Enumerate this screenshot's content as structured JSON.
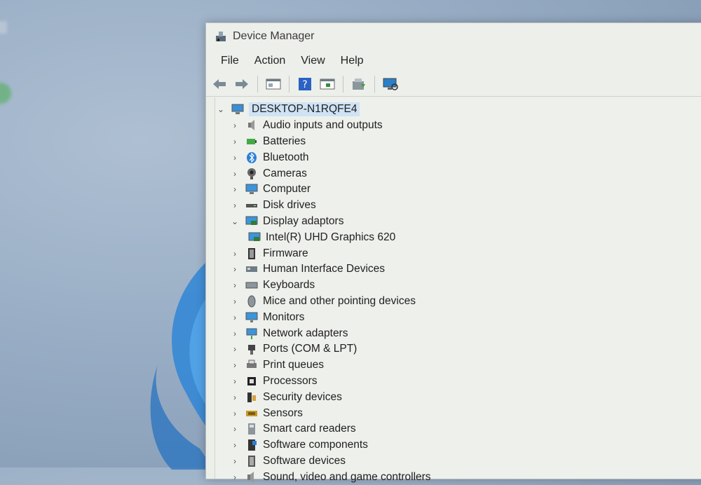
{
  "window": {
    "title": "Device Manager"
  },
  "menu": [
    "File",
    "Action",
    "View",
    "Help"
  ],
  "tree": {
    "root": "DESKTOP-N1RQFE4",
    "categories": [
      {
        "label": "Audio inputs and outputs",
        "icon": "speaker-icon"
      },
      {
        "label": "Batteries",
        "icon": "battery-icon"
      },
      {
        "label": "Bluetooth",
        "icon": "bluetooth-icon"
      },
      {
        "label": "Cameras",
        "icon": "camera-icon"
      },
      {
        "label": "Computer",
        "icon": "computer-icon"
      },
      {
        "label": "Disk drives",
        "icon": "disk-icon"
      },
      {
        "label": "Display adaptors",
        "icon": "display-adapter-icon",
        "expanded": true
      },
      {
        "label": "Intel(R) UHD Graphics 620",
        "icon": "display-adapter-icon",
        "child": true
      },
      {
        "label": "Firmware",
        "icon": "firmware-icon"
      },
      {
        "label": "Human Interface Devices",
        "icon": "hid-icon"
      },
      {
        "label": "Keyboards",
        "icon": "keyboard-icon"
      },
      {
        "label": "Mice and other pointing devices",
        "icon": "mouse-icon"
      },
      {
        "label": "Monitors",
        "icon": "monitor-icon"
      },
      {
        "label": "Network adapters",
        "icon": "network-icon"
      },
      {
        "label": "Ports (COM & LPT)",
        "icon": "port-icon"
      },
      {
        "label": "Print queues",
        "icon": "printer-icon"
      },
      {
        "label": "Processors",
        "icon": "processor-icon"
      },
      {
        "label": "Security devices",
        "icon": "security-icon"
      },
      {
        "label": "Sensors",
        "icon": "sensor-icon"
      },
      {
        "label": "Smart card readers",
        "icon": "smartcard-icon"
      },
      {
        "label": "Software components",
        "icon": "software-component-icon"
      },
      {
        "label": "Software devices",
        "icon": "software-device-icon"
      },
      {
        "label": "Sound, video and game controllers",
        "icon": "sound-icon"
      }
    ]
  },
  "colors": {
    "selection": "#cfe3f5",
    "window_bg": "#eceee8",
    "accent": "#2b7fd6"
  }
}
